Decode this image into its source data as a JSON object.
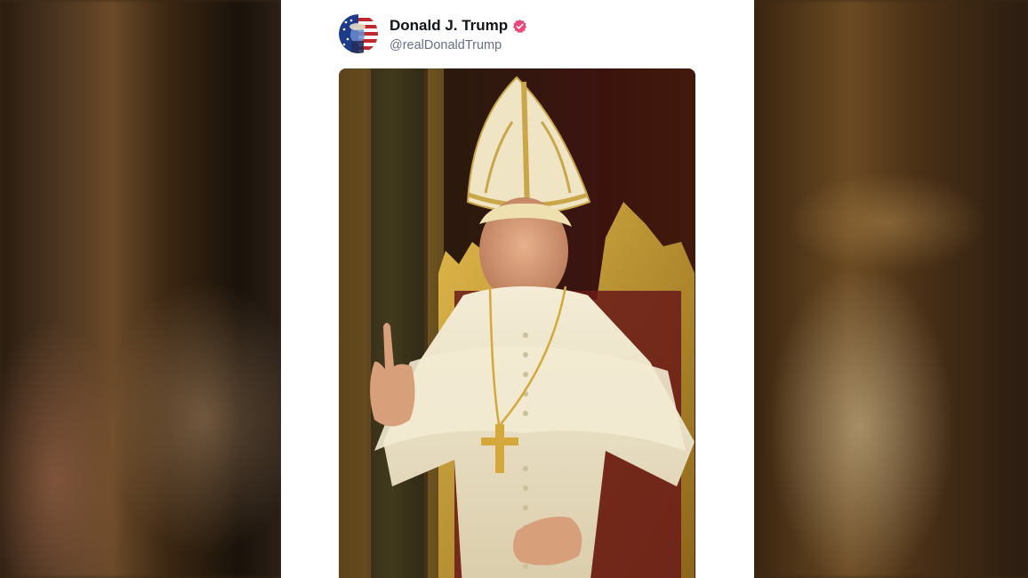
{
  "post": {
    "author_name": "Donald J. Trump",
    "author_handle": "@realDonaldTrump",
    "verified": true,
    "verified_color": "#e8497a",
    "avatar_icon": "flag-portrait-avatar",
    "media": {
      "kind": "image",
      "description_icon": "papal-portrait-image"
    }
  },
  "colors": {
    "card_background": "#ffffff",
    "name_color": "#0f1419",
    "handle_color": "#667085"
  }
}
